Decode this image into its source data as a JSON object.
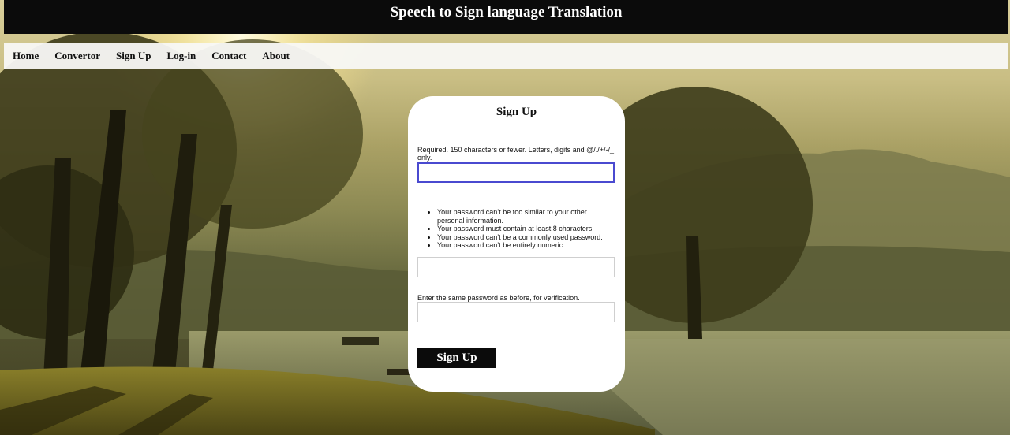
{
  "header": {
    "title": "Speech to Sign language Translation"
  },
  "nav": {
    "items": [
      "Home",
      "Convertor",
      "Sign Up",
      "Log-in",
      "Contact",
      "About"
    ]
  },
  "form": {
    "title": "Sign Up",
    "username": {
      "help_text": "Required. 150 characters or fewer. Letters, digits and @/./+/-/_ only.",
      "value": ""
    },
    "password_rules": [
      "Your password can’t be too similar to your other personal information.",
      "Your password must contain at least 8 characters.",
      "Your password can’t be a commonly used password.",
      "Your password can’t be entirely numeric."
    ],
    "password": {
      "value": ""
    },
    "confirm": {
      "help_text": "Enter the same password as before, for verification.",
      "value": ""
    },
    "submit_label": "Sign Up"
  },
  "colors": {
    "header_bg": "#0b0b0b",
    "nav_bg": "#f8f8f6",
    "card_bg": "#ffffff",
    "button_bg": "#0b0b0b",
    "focus_border": "#4a4ad0"
  }
}
